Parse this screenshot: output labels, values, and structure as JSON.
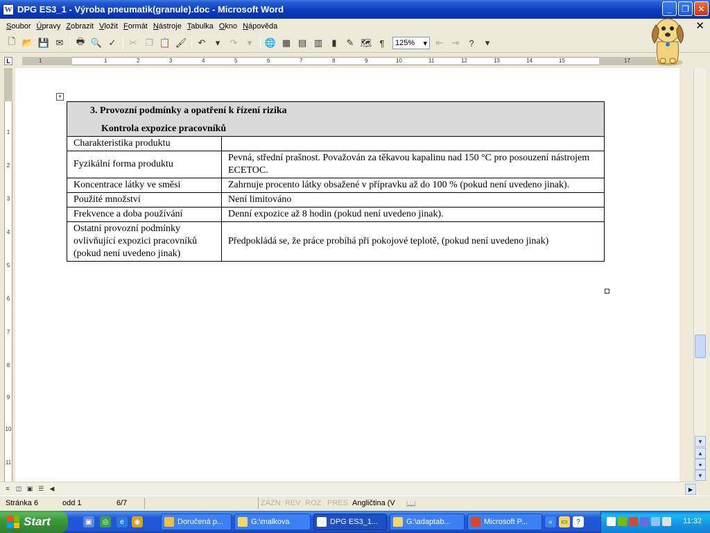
{
  "window": {
    "title": "DPG ES3_1 - Výroba pneumatik(granule).doc - Microsoft Word",
    "app_icon_letter": "W",
    "controls": {
      "minimize": "_",
      "restore": "❐",
      "close": "✕"
    }
  },
  "menu": {
    "items": [
      "Soubor",
      "Úpravy",
      "Zobrazit",
      "Vložit",
      "Formát",
      "Nástroje",
      "Tabulka",
      "Okno",
      "Nápověda"
    ],
    "doc_close": "✕"
  },
  "toolbar": {
    "zoom": "125%"
  },
  "ruler": {
    "h_numbers": [
      "1",
      "1",
      "2",
      "3",
      "4",
      "5",
      "6",
      "7",
      "8",
      "9",
      "10",
      "11",
      "12",
      "13",
      "14",
      "15",
      "17"
    ],
    "v_numbers": [
      "1",
      "2",
      "3",
      "4",
      "5",
      "6",
      "7",
      "8",
      "9",
      "10",
      "11"
    ]
  },
  "table": {
    "header_line1": "3. Provozní podmínky a opatření k řízení rizika",
    "header_line2": "Kontrola expozice pracovníků",
    "rows": [
      {
        "label": "Charakteristika produktu",
        "value": ""
      },
      {
        "label": "Fyzikální forma produktu",
        "value": "Pevná, střední prašnost. Považován za těkavou kapalinu nad 150 °C pro posouzení nástrojem ECETOC."
      },
      {
        "label": "Koncentrace látky ve směsi",
        "value": "Zahrnuje procento látky obsažené v přípravku až do 100 % (pokud není uvedeno jinak)."
      },
      {
        "label": "Použité množství",
        "value": "Není limitováno"
      },
      {
        "label": "Frekvence a doba používání",
        "value": "Denní expozice až 8 hodin (pokud není uvedeno jinak)."
      },
      {
        "label": "Ostatní provozní podmínky ovlivňující expozici pracovníků (pokud není uvedeno jinak)",
        "value": "Předpokládá se, že práce probíhá při pokojové teplotě, (pokud není uvedeno jinak)"
      }
    ]
  },
  "statusbar": {
    "page": "Stránka 6",
    "section": "odd 1",
    "pages": "6/7",
    "rec": "ZÁZN",
    "trk": "REV",
    "ext": "ROZ",
    "ovr": "PRES",
    "language": "Angličtina (V"
  },
  "taskbar": {
    "start": "Start",
    "tasks": [
      "Doručená p...",
      "G:\\malkova",
      "DPG ES3_1...",
      "G:\\adaptab...",
      "Microsoft P..."
    ],
    "clock": "11:32"
  }
}
